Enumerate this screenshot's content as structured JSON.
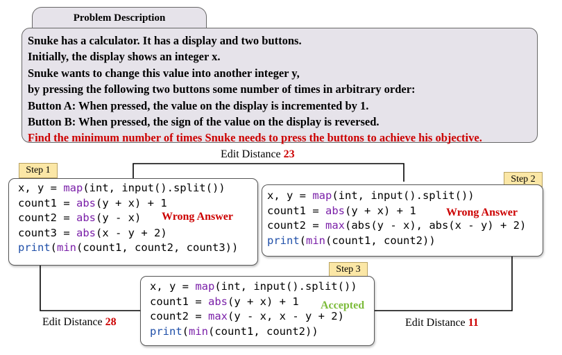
{
  "problem": {
    "header": "Problem Description",
    "lines": [
      "Snuke has a calculator. It has a display and two buttons.",
      "Initially, the display shows an integer x.",
      "Snuke wants to change this value into another integer y,",
      "by pressing the following two buttons some number of times in arbitrary order:",
      "Button A: When pressed, the value on the display is incremented by 1.",
      "Button B: When pressed, the sign of the value on the display is reversed."
    ],
    "objective": "Find the minimum number of times Snuke needs to press the buttons to achieve his objective."
  },
  "edges": {
    "step1_step2": {
      "label": "Edit Distance",
      "value": "23"
    },
    "step1_step3": {
      "label": "Edit Distance",
      "value": "28"
    },
    "step2_step3": {
      "label": "Edit Distance",
      "value": "11"
    }
  },
  "steps": {
    "step1": {
      "tag": "Step 1",
      "verdict": "Wrong Answer",
      "code": [
        [
          [
            "",
            "x, y = "
          ],
          [
            "fn",
            "map"
          ],
          [
            "",
            "(int, input().split())"
          ]
        ],
        [
          [
            "",
            "count1 = "
          ],
          [
            "fn",
            "abs"
          ],
          [
            "",
            "(y + x) + 1"
          ]
        ],
        [
          [
            "",
            "count2 = "
          ],
          [
            "fn",
            "abs"
          ],
          [
            "",
            "(y - x)"
          ]
        ],
        [
          [
            "",
            "count3 = "
          ],
          [
            "fn",
            "abs"
          ],
          [
            "",
            "(x - y + 2)"
          ]
        ],
        [
          [
            "bi",
            "print"
          ],
          [
            "",
            "("
          ],
          [
            "fn",
            "min"
          ],
          [
            "",
            "(count1, count2, count3))"
          ]
        ]
      ]
    },
    "step2": {
      "tag": "Step 2",
      "verdict": "Wrong Answer",
      "code": [
        [
          [
            "",
            "x, y = "
          ],
          [
            "fn",
            "map"
          ],
          [
            "",
            "(int, input().split())"
          ]
        ],
        [
          [
            "",
            "count1 = "
          ],
          [
            "fn",
            "abs"
          ],
          [
            "",
            "(y + x) + 1"
          ]
        ],
        [
          [
            "",
            "count2 = "
          ],
          [
            "fn",
            "max"
          ],
          [
            "",
            "(abs(y - x), abs(x - y) + 2)"
          ]
        ],
        [
          [
            "bi",
            "print"
          ],
          [
            "",
            "("
          ],
          [
            "fn",
            "min"
          ],
          [
            "",
            "(count1, count2))"
          ]
        ]
      ]
    },
    "step3": {
      "tag": "Step 3",
      "verdict": "Accepted",
      "code": [
        [
          [
            "",
            "x, y = "
          ],
          [
            "fn",
            "map"
          ],
          [
            "",
            "(int, input().split())"
          ]
        ],
        [
          [
            "",
            "count1 = "
          ],
          [
            "fn",
            "abs"
          ],
          [
            "",
            "(y + x) + 1"
          ]
        ],
        [
          [
            "",
            "count2 = "
          ],
          [
            "fn",
            "max"
          ],
          [
            "",
            "(y - x, x - y + 2)"
          ]
        ],
        [
          [
            "bi",
            "print"
          ],
          [
            "",
            "("
          ],
          [
            "fn",
            "min"
          ],
          [
            "",
            "(count1, count2))"
          ]
        ]
      ]
    }
  },
  "colors": {
    "panel_bg": "#e6e3ea",
    "tag_bg": "#fbe7a6",
    "wrong": "#cc0000",
    "accepted": "#7cbb3a",
    "function": "#7a1fa8",
    "builtin": "#1f4fa8"
  }
}
